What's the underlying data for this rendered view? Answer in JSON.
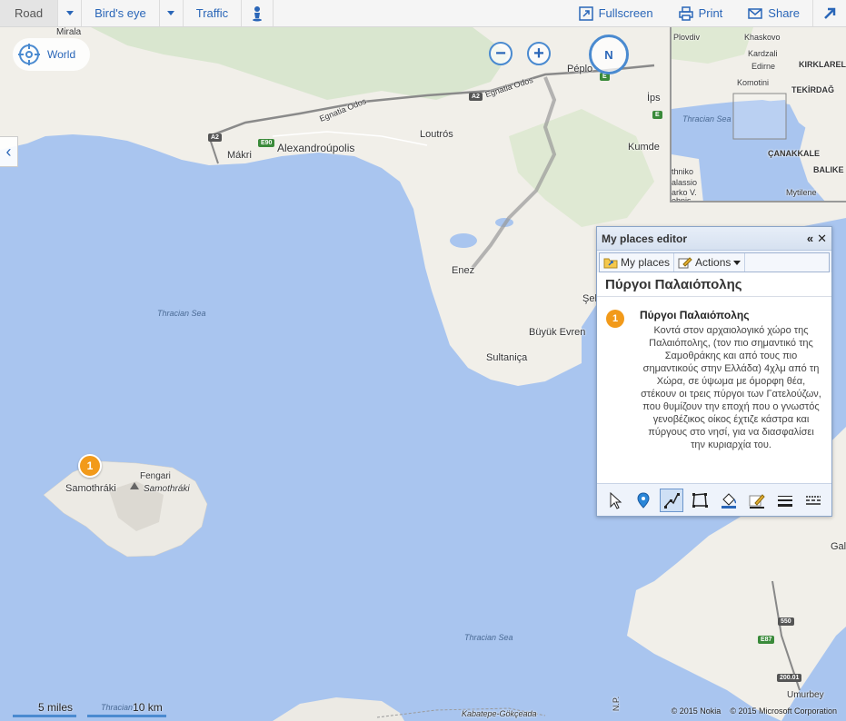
{
  "toolbar": {
    "road": "Road",
    "birds_eye": "Bird's eye",
    "traffic": "Traffic",
    "fullscreen": "Fullscreen",
    "print": "Print",
    "share": "Share"
  },
  "controls": {
    "world": "World",
    "compass": "N"
  },
  "map_labels": {
    "mirala": "Mirala",
    "makri": "Mákri",
    "alexandroupolis": "Alexandroúpolis",
    "loutros": "Loutrós",
    "peplos": "Péplo",
    "ips": "İps",
    "kumde": "Kumde",
    "enez": "Enez",
    "sek": "Şek",
    "buyuk_evren": "Büyük Evren",
    "sultanica": "Sultaniça",
    "samothraki": "Samothráki",
    "fengari": "Fengari",
    "samothraki_it": "Samothráki",
    "thracian_sea_1": "Thracian Sea",
    "thracian_sea_2": "Thracian Sea",
    "thracian_sea_3": "Thracian",
    "egnatia_1": "Egnatia Odos",
    "egnatia_2": "Egnatia Odos",
    "kabatepe": "Kabatepe-Gökçeada",
    "gal": "Gal",
    "umurbey": "Umurbey",
    "np": "N.P."
  },
  "shields": {
    "a2_1": "A2",
    "a2_2": "A2",
    "e90": "E90",
    "e": "E",
    "s550": "550",
    "e87": "E87",
    "r200": "200.01"
  },
  "minimap": {
    "plovdiv": "Plovdiv",
    "khaskovo": "Khaskovo",
    "kardzhali": "Kardzali",
    "edirne": "Edirne",
    "kirklarel": "KIRKLAREL",
    "komotini": "Komotini",
    "tekirdag": "TEKİRDAĞ",
    "thracian_sea": "Thracian Sea",
    "canakkale": "ÇANAKKALE",
    "balike": "BALIKE",
    "thniko": "thniko",
    "alassio": "alassio",
    "arko": "arko V.",
    "ehnis": "ehnis",
    "mytilene": "Mytilene"
  },
  "editor": {
    "title": "My places editor",
    "tab_my_places": "My places",
    "tab_actions": "Actions",
    "place_title": "Πύργοι Παλαιόπολης",
    "item": {
      "number": "1",
      "name": "Πύργοι Παλαιόπολης",
      "description": "Κοντά στον αρχαιολογικό χώρο της Παλαιόπολης, (τον πιο σημαντικό της Σαμοθράκης και από τους πιο σημαντικούς στην Ελλάδα) 4χλμ από τη Χώρα, σε ύψωμα με όμορφη θέα, στέκουν οι τρεις πύργοι των Γατελούζων, που θυμίζουν την εποχή που ο γνωστός γενοβέζικος οίκος έχτιζε κάστρα και πύργους στο νησί, για να διασφαλίσει την κυριαρχία του."
    }
  },
  "map_pin": "1",
  "scale": {
    "miles": "5 miles",
    "km": "10 km"
  },
  "copyright": {
    "nokia": "© 2015 Nokia",
    "microsoft": "© 2015 Microsoft Corporation"
  },
  "colors": {
    "water": "#a9c5ef",
    "land": "#f1efe9",
    "accent": "#2a66b8",
    "pin": "#f29a1a"
  }
}
